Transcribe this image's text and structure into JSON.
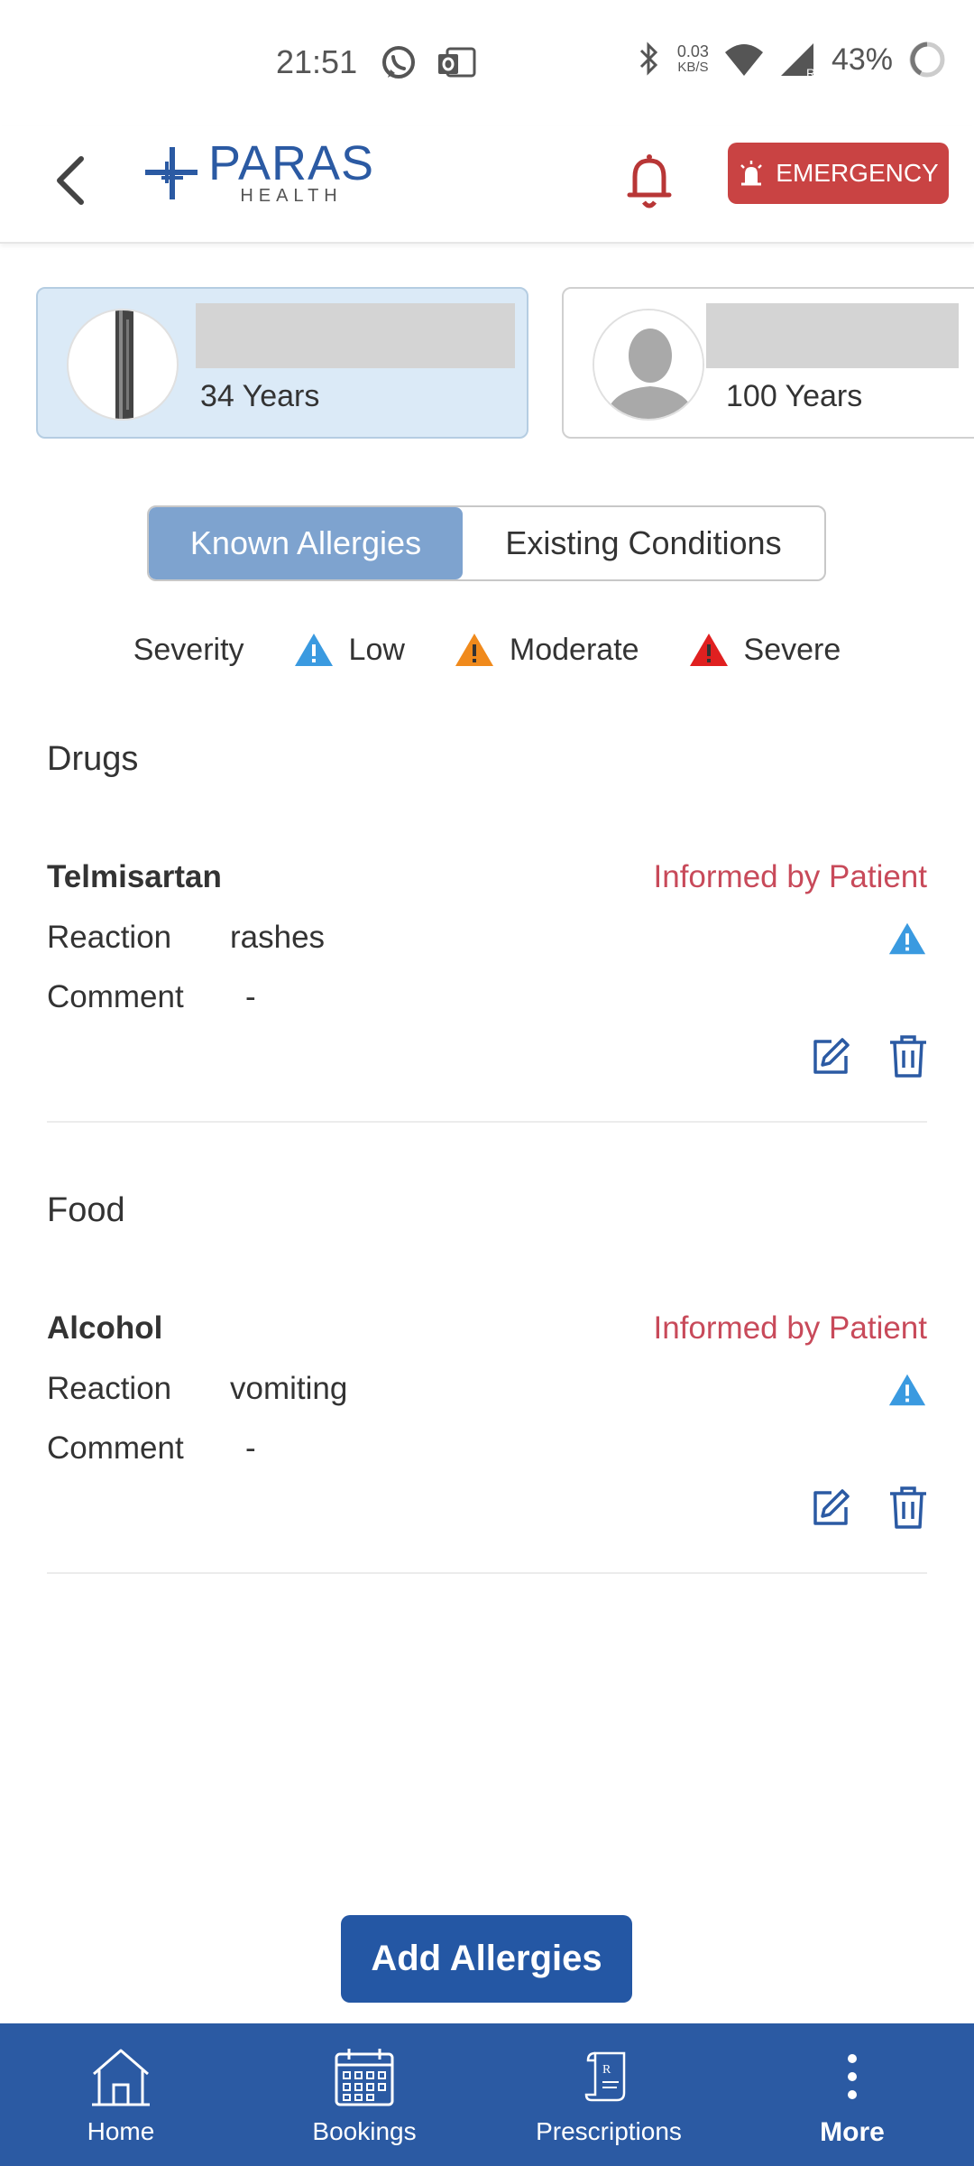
{
  "status_bar": {
    "time": "21:51",
    "net_speed_value": "0.03",
    "net_speed_unit": "KB/S",
    "battery": "43%"
  },
  "header": {
    "logo_name": "PARAS",
    "logo_sub": "HEALTH",
    "emergency_label": "EMERGENCY",
    "brand_color": "#2b5aa3",
    "emergency_color": "#c94343"
  },
  "profiles": [
    {
      "age": "34 Years",
      "active": true
    },
    {
      "age": "100 Years",
      "active": false
    }
  ],
  "tabs": {
    "known_allergies": "Known Allergies",
    "existing_conditions": "Existing Conditions",
    "selected": "Known Allergies"
  },
  "legend": {
    "title": "Severity",
    "low": "Low",
    "moderate": "Moderate",
    "severe": "Severe",
    "low_color": "#3a9ae0",
    "moderate_color": "#f08a1c",
    "severe_color": "#e02020"
  },
  "sections": [
    {
      "title": "Drugs",
      "entries": [
        {
          "name": "Telmisartan",
          "source": "Informed by Patient",
          "reaction_label": "Reaction",
          "reaction": "rashes",
          "comment_label": "Comment",
          "comment": "-",
          "severity": "Low"
        }
      ]
    },
    {
      "title": "Food",
      "entries": [
        {
          "name": "Alcohol",
          "source": "Informed by Patient",
          "reaction_label": "Reaction",
          "reaction": "vomiting",
          "comment_label": "Comment",
          "comment": "-",
          "severity": "Low"
        }
      ]
    }
  ],
  "add_button": "Add Allergies",
  "bottom_nav": {
    "home": "Home",
    "bookings": "Bookings",
    "prescriptions": "Prescriptions",
    "more": "More"
  }
}
